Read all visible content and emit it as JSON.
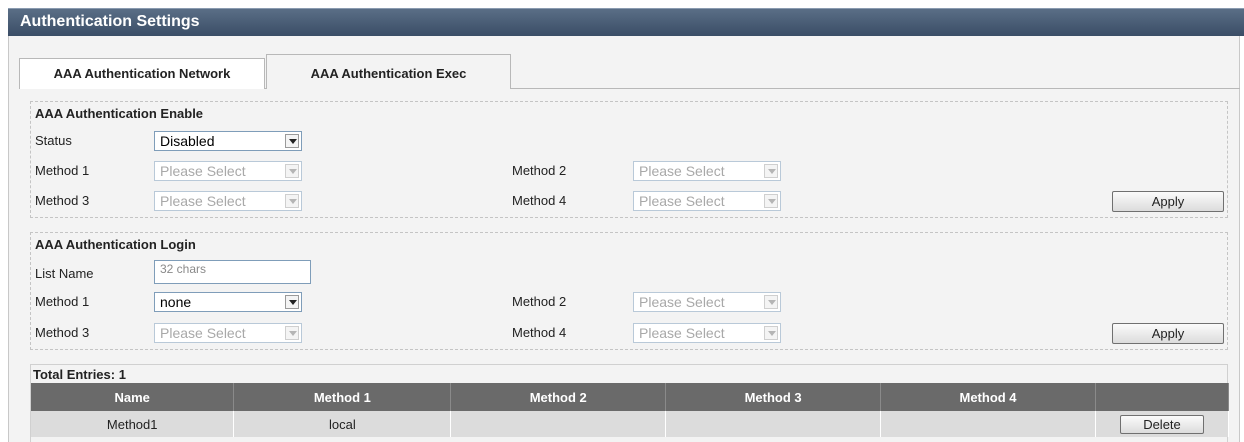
{
  "page_title": "Authentication Settings",
  "tabs": [
    {
      "label": "AAA Authentication Network",
      "active": false
    },
    {
      "label": "AAA Authentication Exec",
      "active": true
    }
  ],
  "enable_section": {
    "heading": "AAA Authentication Enable",
    "status_label": "Status",
    "status_value": "Disabled",
    "method1_label": "Method 1",
    "method1_value": "Please Select",
    "method2_label": "Method 2",
    "method2_value": "Please Select",
    "method3_label": "Method 3",
    "method3_value": "Please Select",
    "method4_label": "Method 4",
    "method4_value": "Please Select",
    "apply_label": "Apply"
  },
  "login_section": {
    "heading": "AAA Authentication Login",
    "list_name_label": "List Name",
    "list_name_placeholder": "32 chars",
    "method1_label": "Method 1",
    "method1_value": "none",
    "method2_label": "Method 2",
    "method2_value": "Please Select",
    "method3_label": "Method 3",
    "method3_value": "Please Select",
    "method4_label": "Method 4",
    "method4_value": "Please Select",
    "apply_label": "Apply"
  },
  "table": {
    "total_entries": "Total Entries: 1",
    "headers": [
      "Name",
      "Method 1",
      "Method 2",
      "Method 3",
      "Method 4",
      ""
    ],
    "rows": [
      {
        "name": "Method1",
        "method1": "local",
        "method2": "",
        "method3": "",
        "method4": "",
        "action": "Delete"
      }
    ]
  },
  "colors": {
    "title_bar": "#3a4d66",
    "table_header": "#6a6a6a",
    "table_row": "#dcdcdc",
    "panel_bg": "#f3f3f3"
  }
}
